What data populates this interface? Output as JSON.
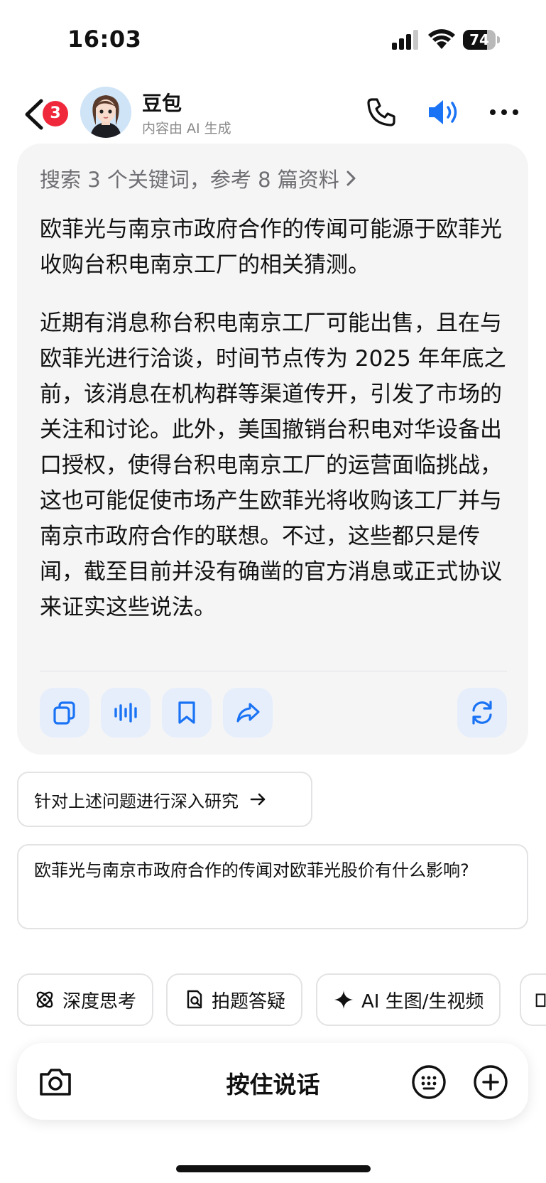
{
  "status_bar": {
    "time": "16:03",
    "battery_level": "74"
  },
  "header": {
    "back_badge_count": "3",
    "bot_name": "豆包",
    "bot_subtitle": "内容由 AI 生成",
    "icons": [
      "back-icon",
      "phone-icon",
      "speaker-icon",
      "more-icon"
    ],
    "speaker_active_color": "#1a73f5"
  },
  "answer": {
    "references_label": "搜索 3 个关键词，参考 8 篇资料",
    "paragraphs": [
      "欧菲光与南京市政府合作的传闻可能源于欧菲光收购台积电南京工厂的相关猜测。",
      "近期有消息称台积电南京工厂可能出售，且在与欧菲光进行洽谈，时间节点传为 2025 年年底之前，该消息在机构群等渠道传开，引发了市场的关注和讨论。此外，美国撤销台积电对华设备出口授权，使得台积电南京工厂的运营面临挑战，这也可能促使市场产生欧菲光将收购该工厂并与南京市政府合作的联想。不过，这些都只是传闻，截至目前并没有确凿的官方消息或正式协议来证实这些说法。"
    ],
    "actions": [
      "copy-icon",
      "voice-playback-icon",
      "bookmark-icon",
      "share-icon",
      "regenerate-icon"
    ]
  },
  "suggestions": [
    "针对上述问题进行深入研究",
    "欧菲光与南京市政府合作的传闻对欧菲光股价有什么影响?"
  ],
  "quick_actions": [
    {
      "label": "深度思考",
      "icon": "atom-icon"
    },
    {
      "label": "拍题答疑",
      "icon": "scan-question-icon"
    },
    {
      "label": "AI 生图/生视频",
      "icon": "sparkle-icon"
    }
  ],
  "input": {
    "hold_to_talk": "按住说话"
  },
  "colors": {
    "accent": "#1a73f5",
    "card_bg": "#f5f5f6",
    "badge": "#f0283c"
  }
}
